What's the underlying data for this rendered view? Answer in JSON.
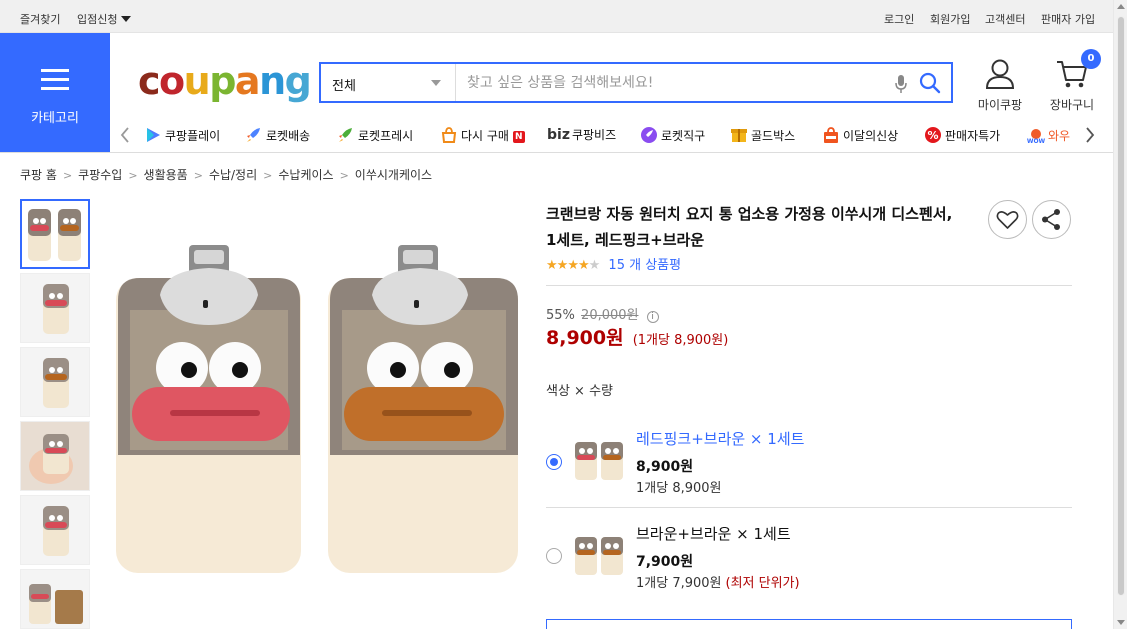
{
  "topbar": {
    "bookmark": "즐겨찾기",
    "apply": "입점신청",
    "login": "로그인",
    "signup": "회원가입",
    "customer_center": "고객센터",
    "seller_signup": "판매자 가입"
  },
  "header": {
    "category_label": "카테고리",
    "logo_letters": [
      "c",
      "o",
      "u",
      "p",
      "a",
      "n",
      "g"
    ],
    "search_category": "전체",
    "search_placeholder": "찾고 싶은 상품을 검색해보세요!",
    "mypage_label": "마이쿠팡",
    "cart_label": "장바구니",
    "cart_count": "0",
    "brand_color": "#346aff"
  },
  "service_nav": [
    {
      "label": "쿠팡플레이",
      "icon": "coupang-play-icon"
    },
    {
      "label": "로켓배송",
      "icon": "rocket-icon"
    },
    {
      "label": "로켓프레시",
      "icon": "rocket-fresh-icon"
    },
    {
      "label": "다시 구매",
      "icon": "rebuy-icon",
      "badge": "N"
    },
    {
      "label": "쿠팡비즈",
      "icon": "biz-icon",
      "prefix": "biz"
    },
    {
      "label": "로켓직구",
      "icon": "rocket-global-icon"
    },
    {
      "label": "골드박스",
      "icon": "goldbox-icon"
    },
    {
      "label": "이달의신상",
      "icon": "new-bag-icon"
    },
    {
      "label": "판매자특가",
      "icon": "seller-deal-icon"
    },
    {
      "label": "와우",
      "icon": "wow-icon"
    }
  ],
  "breadcrumb": [
    "쿠팡 홈",
    "쿠팡수입",
    "생활용품",
    "수납/정리",
    "수납케이스",
    "이쑤시개케이스"
  ],
  "product": {
    "title": "크랜브랑 자동 원터치 요지 통 업소용 가정용 이쑤시개 디스펜서, 1세트, 레드핑크+브라운",
    "rating": 4.5,
    "review_count": "15 개 상품평",
    "discount_rate": "55%",
    "original_price": "20,000원",
    "sale_price": "8,900원",
    "unit_price": "(1개당 8,900원)",
    "option_label": "색상 × 수량",
    "options": [
      {
        "name": "레드핑크+브라운 × 1세트",
        "price": "8,900원",
        "unit": "1개당 8,900원",
        "lowest": "",
        "selected": true
      },
      {
        "name": "브라운+브라운 × 1세트",
        "price": "7,900원",
        "unit": "1개당 7,900원",
        "lowest": "(최저 단위가)",
        "selected": false
      }
    ]
  }
}
